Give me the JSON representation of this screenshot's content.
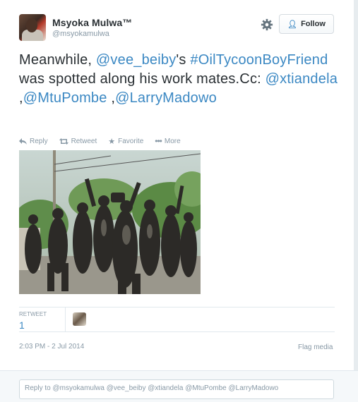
{
  "user": {
    "name": "Msyoka Mulwa™",
    "handle": "@msyokamulwa"
  },
  "follow_label": "Follow",
  "tweet": {
    "segments": [
      {
        "text": "Meanwhile, ",
        "link": false
      },
      {
        "text": "@vee_beiby",
        "link": true
      },
      {
        "text": "'s ",
        "link": false
      },
      {
        "text": "#OilTycoonBoyFriend",
        "link": true
      },
      {
        "text": " was spotted along his work mates.Cc: ",
        "link": false
      },
      {
        "text": "@xtiandela",
        "link": true
      },
      {
        "text": " ,",
        "link": false
      },
      {
        "text": "@MtuPombe",
        "link": true
      },
      {
        "text": " ,",
        "link": false
      },
      {
        "text": "@LarryMadowo",
        "link": true
      }
    ]
  },
  "actions": [
    {
      "label": "Reply",
      "icon": "reply-icon"
    },
    {
      "label": "Retweet",
      "icon": "retweet-icon"
    },
    {
      "label": "Favorite",
      "icon": "star-icon"
    },
    {
      "label": "More",
      "icon": "more-icon"
    }
  ],
  "stats": {
    "retweet_label": "RETWEET",
    "retweet_count": "1"
  },
  "timestamp": "2:03 PM - 2 Jul 2014",
  "flag_label": "Flag media",
  "reply_placeholder": "Reply to @msyokamulwa @vee_beiby @xtiandela @MtuPombe @LarryMadowo",
  "colors": {
    "link": "#3b88c3",
    "muted": "#8899a6",
    "text": "#292f33"
  }
}
